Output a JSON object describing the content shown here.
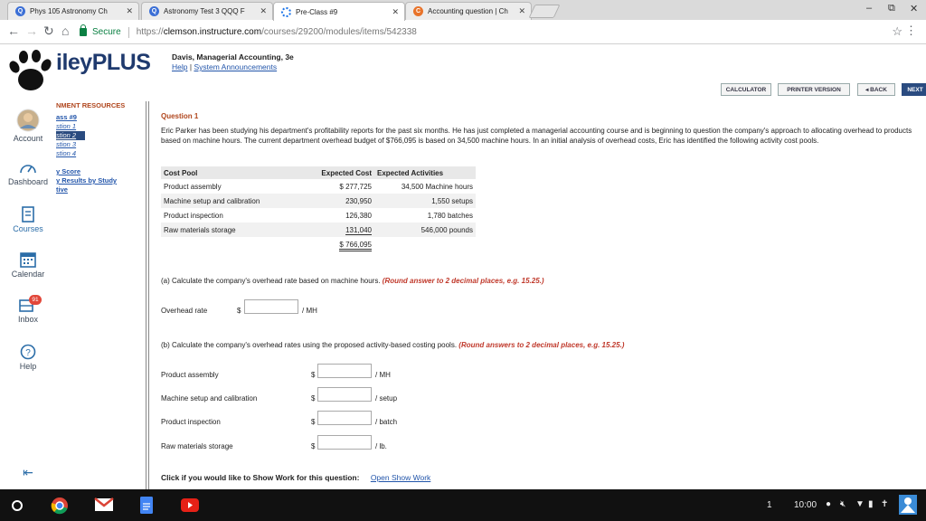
{
  "browser": {
    "tabs": [
      {
        "title": "Phys 105 Astronomy Ch",
        "fav_color": "#3b6fd6",
        "fav_glyph": "Q"
      },
      {
        "title": "Astronomy Test 3 QQQ F",
        "fav_color": "#3b6fd6",
        "fav_glyph": "Q"
      },
      {
        "title": "Pre-Class #9",
        "fav_color": "#1a73e8",
        "fav_glyph": ""
      },
      {
        "title": "Accounting question | Ch",
        "fav_color": "#e8732a",
        "fav_glyph": "C"
      }
    ],
    "secure_label": "Secure",
    "url_proto": "https://",
    "url_host": "clemson.instructure.com",
    "url_path": "/courses/29200/modules/items/542338"
  },
  "nav": {
    "account": "Account",
    "dashboard": "Dashboard",
    "courses": "Courses",
    "calendar": "Calendar",
    "inbox": "Inbox",
    "inbox_badge": "91",
    "help": "Help"
  },
  "header": {
    "brand": "ileyPLUS",
    "book_title": "Davis, Managerial Accounting, 3e",
    "help_link": "Help",
    "divider": "|",
    "announcements_link": "System Announcements",
    "buttons": {
      "calculator": "CALCULATOR",
      "printer": "PRINTER VERSION",
      "back": "◂ BACK",
      "next": "NEXT"
    }
  },
  "resources": {
    "heading": "NMENT RESOURCES",
    "links": [
      "ass #9",
      "stion 1",
      "stion 2",
      "stion 3",
      "stion 4"
    ],
    "score": "y Score",
    "results_line1": "y Results by Study",
    "results_line2": "tive"
  },
  "question": {
    "title": "Question 1",
    "text": "Eric Parker has been studying his department's profitability reports for the past six months. He has just completed a managerial accounting course and is beginning to question the company's approach to allocating overhead to products based on machine hours. The current department overhead budget of $766,095 is based on 34,500 machine hours. In an initial analysis of overhead costs, Eric has identified the following activity cost pools.",
    "table": {
      "headers": [
        "Cost Pool",
        "Expected Cost",
        "Expected Activities"
      ],
      "rows": [
        {
          "pool": "Product assembly",
          "cost": "$ 277,725",
          "activity": "34,500 Machine hours"
        },
        {
          "pool": "Machine setup and calibration",
          "cost": "230,950",
          "activity": "1,550 setups"
        },
        {
          "pool": "Product inspection",
          "cost": "126,380",
          "activity": "1,780 batches"
        },
        {
          "pool": "Raw materials storage",
          "cost": "131,040",
          "activity": "546,000 pounds"
        }
      ],
      "total": "$ 766,095"
    },
    "part_a": "(a) Calculate the company's overhead rate based on machine hours.",
    "part_a_round": "(Round answer to 2 decimal places, e.g. 15.25.)",
    "overhead_label": "Overhead rate",
    "overhead_dollar": "$",
    "overhead_unit": "/ MH",
    "part_b": "(b) Calculate the company's overhead rates using the proposed activity-based costing pools.",
    "part_b_round": "(Round answers to 2 decimal places, e.g. 15.25.)",
    "rates": [
      {
        "label": "Product assembly",
        "dollar": "$",
        "unit": "/ MH"
      },
      {
        "label": "Machine setup and calibration",
        "dollar": "$",
        "unit": "/ setup"
      },
      {
        "label": "Product inspection",
        "dollar": "$",
        "unit": "/ batch"
      },
      {
        "label": "Raw materials storage",
        "dollar": "$",
        "unit": "/ lb."
      }
    ],
    "show_work_text": "Click if you would like to Show Work for this question:",
    "show_work_link": "Open Show Work"
  },
  "taskbar": {
    "page": "1",
    "time": "10:00"
  }
}
